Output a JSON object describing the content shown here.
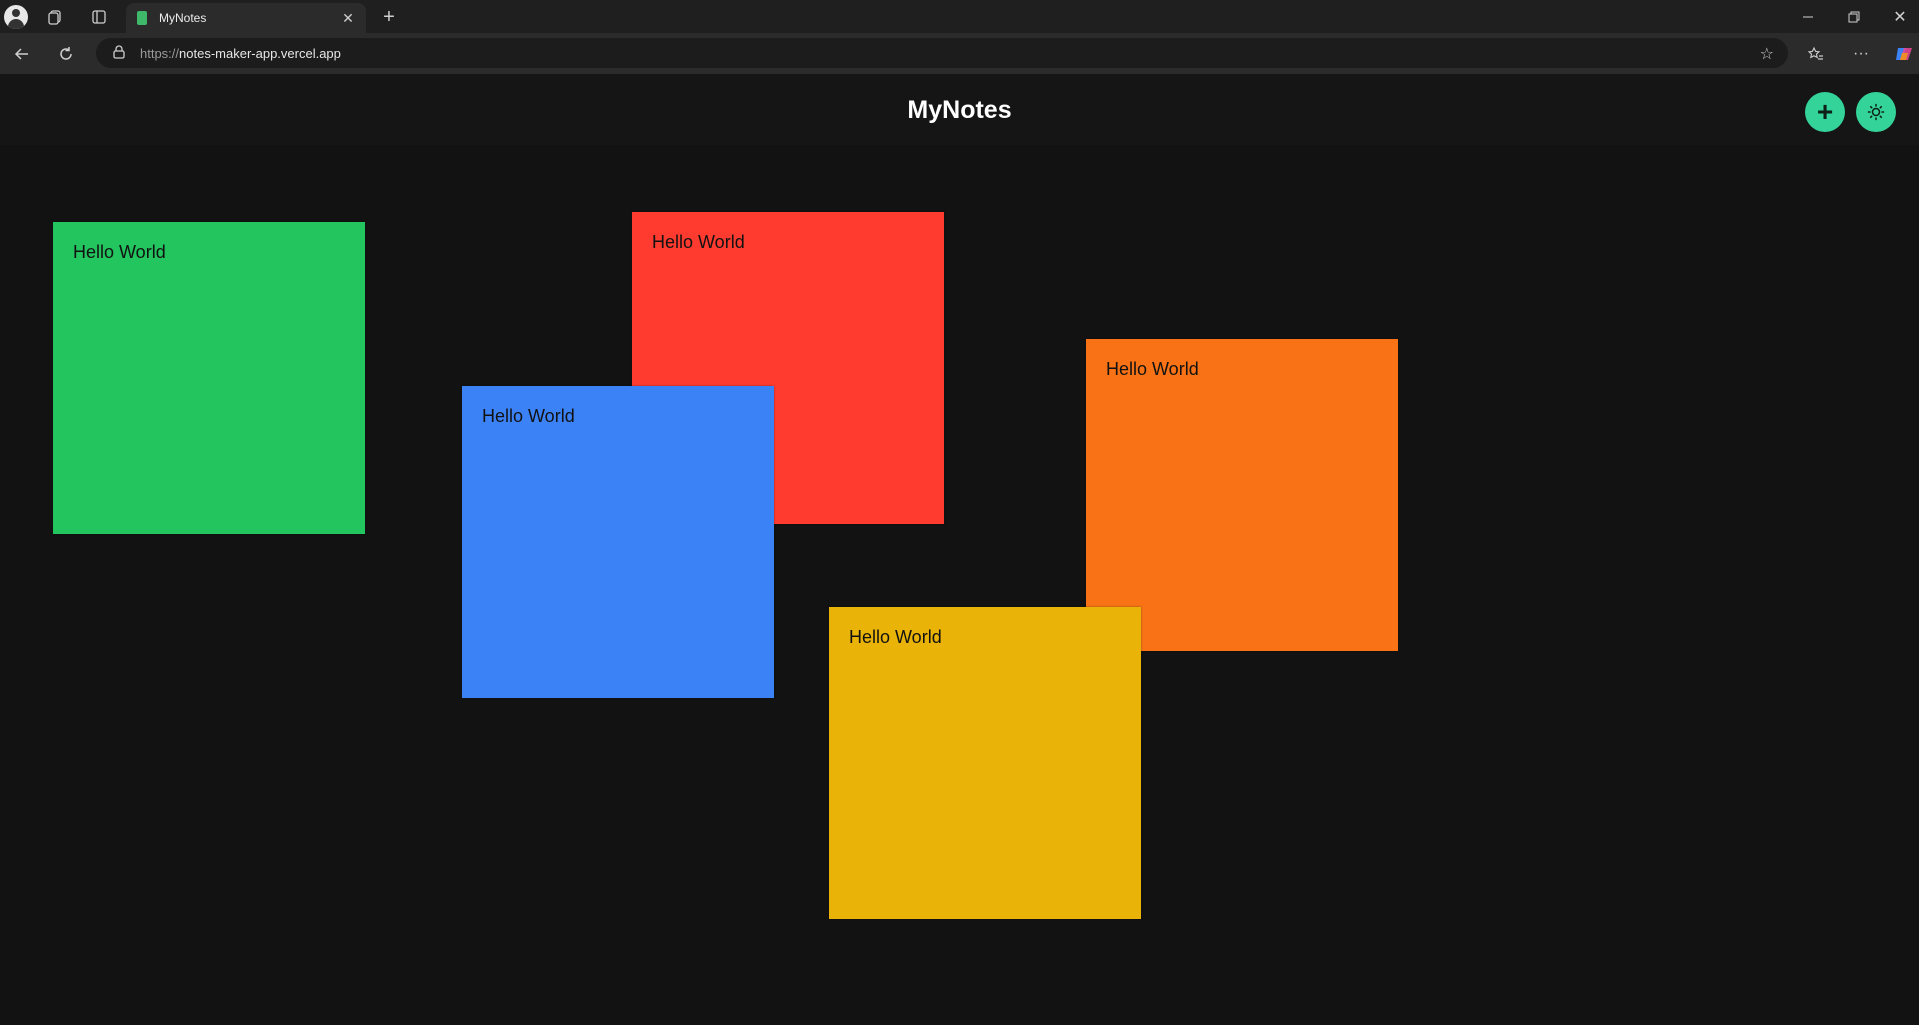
{
  "browser": {
    "tab_title": "MyNotes",
    "url_proto": "https://",
    "url_host": "notes-maker-app.vercel.app"
  },
  "app": {
    "title": "MyNotes",
    "add_button_icon": "plus-icon",
    "theme_button_icon": "sun-icon"
  },
  "notes": [
    {
      "text": "Hello World",
      "color": "#22c55e"
    },
    {
      "text": "Hello World",
      "color": "#ff3b30"
    },
    {
      "text": "Hello World",
      "color": "#3b82f6"
    },
    {
      "text": "Hello World",
      "color": "#f97316"
    },
    {
      "text": "Hello World",
      "color": "#eab308"
    }
  ]
}
